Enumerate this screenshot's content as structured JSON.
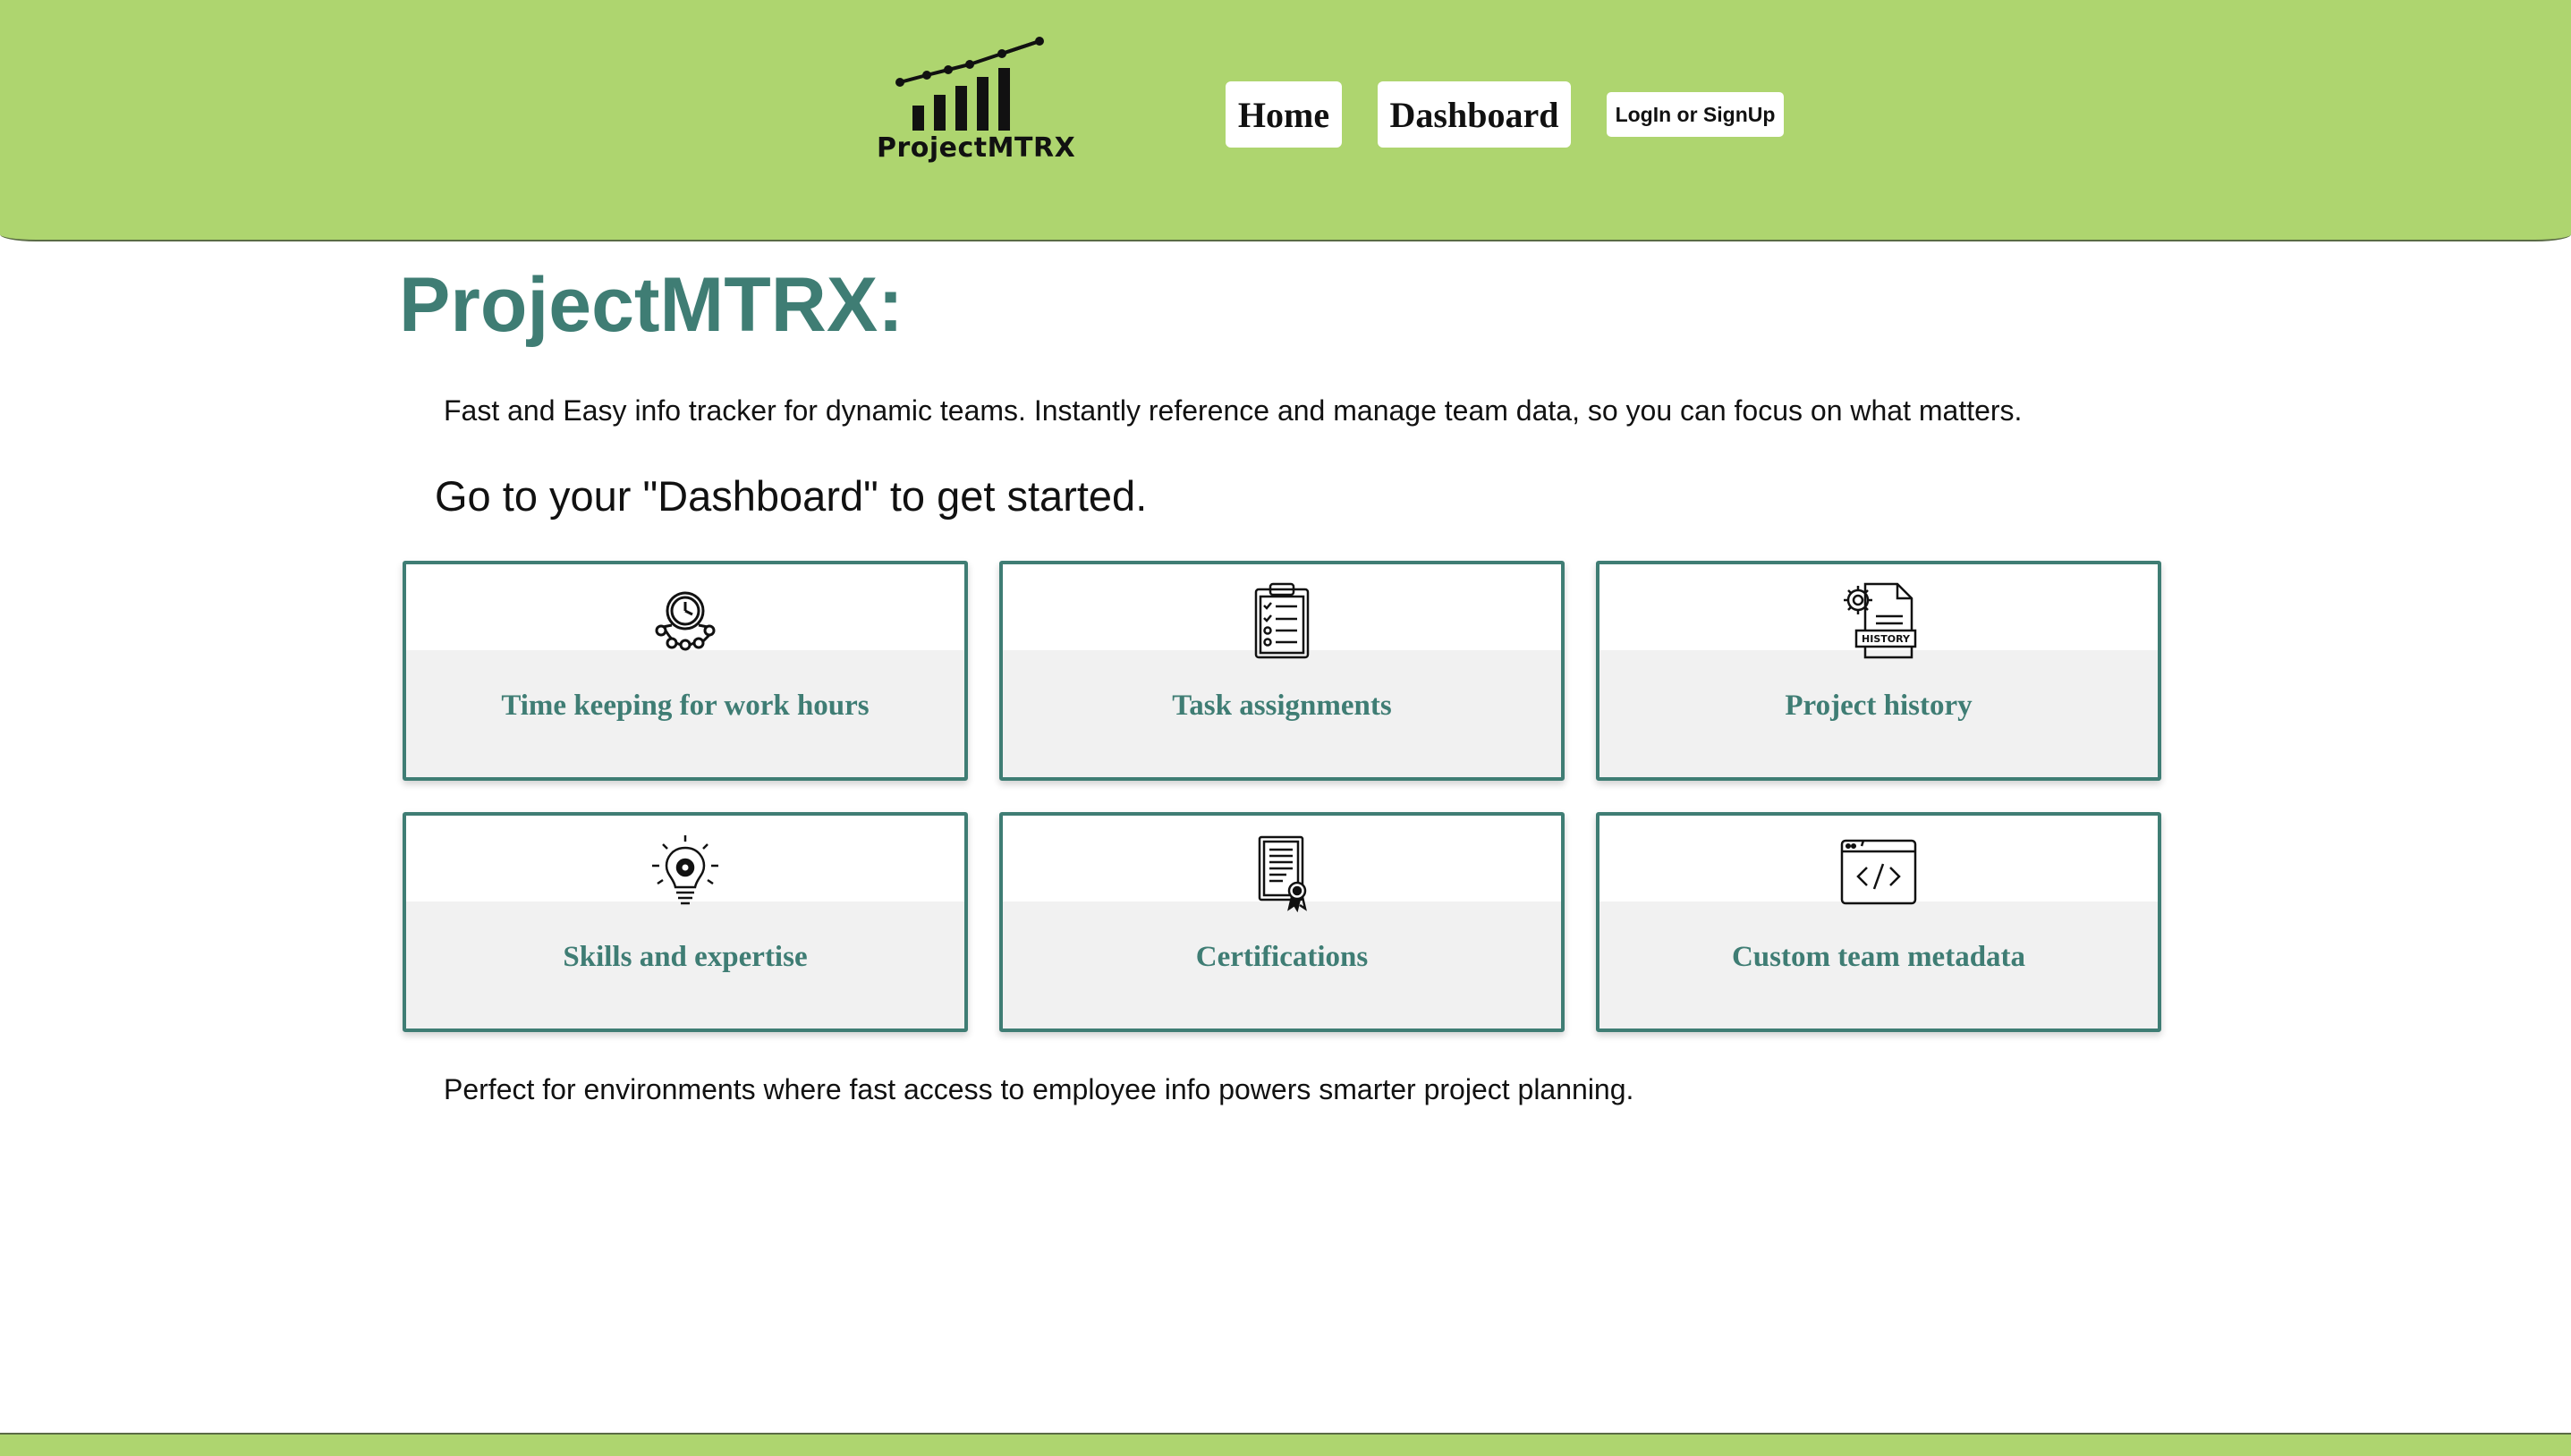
{
  "header": {
    "logo_text": "ProjectMTRX",
    "logo_icon": "bar-chart-trend-icon",
    "nav": {
      "home_label": "Home",
      "dashboard_label": "Dashboard",
      "login_label": "LogIn or SignUp"
    }
  },
  "main": {
    "title": "ProjectMTRX:",
    "intro": "Fast and Easy info tracker for dynamic teams. Instantly reference and manage team data, so you can focus on what matters.",
    "cta": "Go to your \"Dashboard\" to get started.",
    "features": [
      {
        "label": "Time keeping for work hours",
        "icon": "clock-network-icon"
      },
      {
        "label": "Task assignments",
        "icon": "clipboard-checklist-icon"
      },
      {
        "label": "Project history",
        "icon": "document-history-icon"
      },
      {
        "label": "Skills and expertise",
        "icon": "lightbulb-gear-icon"
      },
      {
        "label": "Certifications",
        "icon": "certificate-icon"
      },
      {
        "label": "Custom team metadata",
        "icon": "code-window-icon"
      }
    ],
    "outro": "Perfect for environments where fast access to employee info powers smarter project planning."
  },
  "colors": {
    "header_bg": "#aed56f",
    "accent": "#3f7d74",
    "card_bottom_bg": "#f1f1f1"
  }
}
